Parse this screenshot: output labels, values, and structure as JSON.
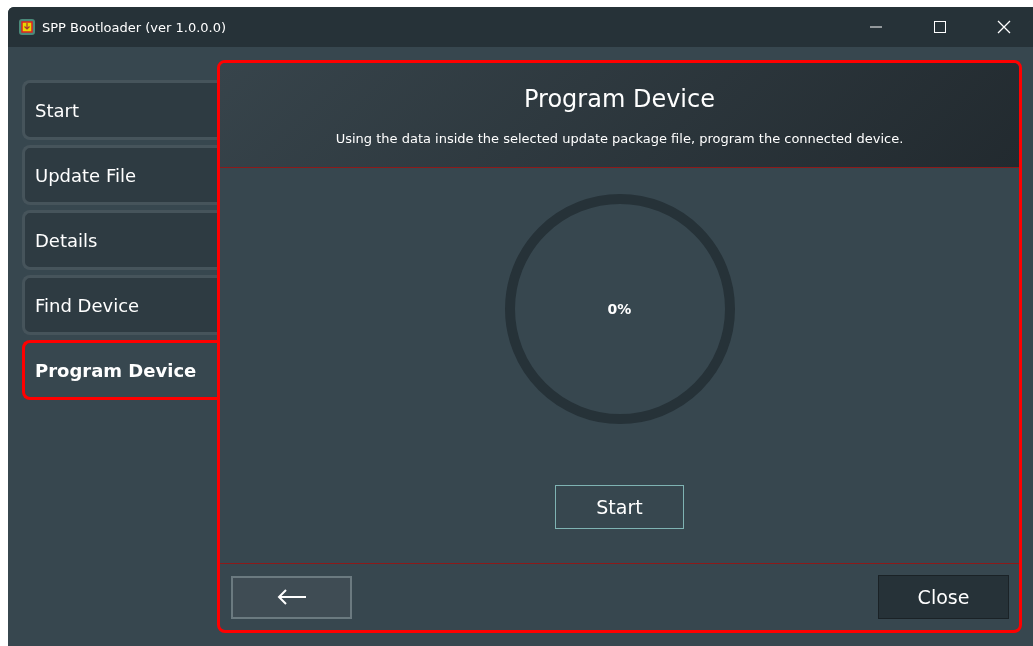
{
  "window": {
    "title": "SPP Bootloader (ver 1.0.0.0)"
  },
  "sidebar": {
    "items": [
      {
        "label": "Start",
        "selected": false
      },
      {
        "label": "Update File",
        "selected": false
      },
      {
        "label": "Details",
        "selected": false
      },
      {
        "label": "Find Device",
        "selected": false
      },
      {
        "label": "Program Device",
        "selected": true
      }
    ]
  },
  "panel": {
    "title": "Program Device",
    "description": "Using the data inside the selected update package file, program the connected device.",
    "progress": {
      "reading": "0%"
    },
    "start_button": "Start",
    "close_button": "Close"
  }
}
